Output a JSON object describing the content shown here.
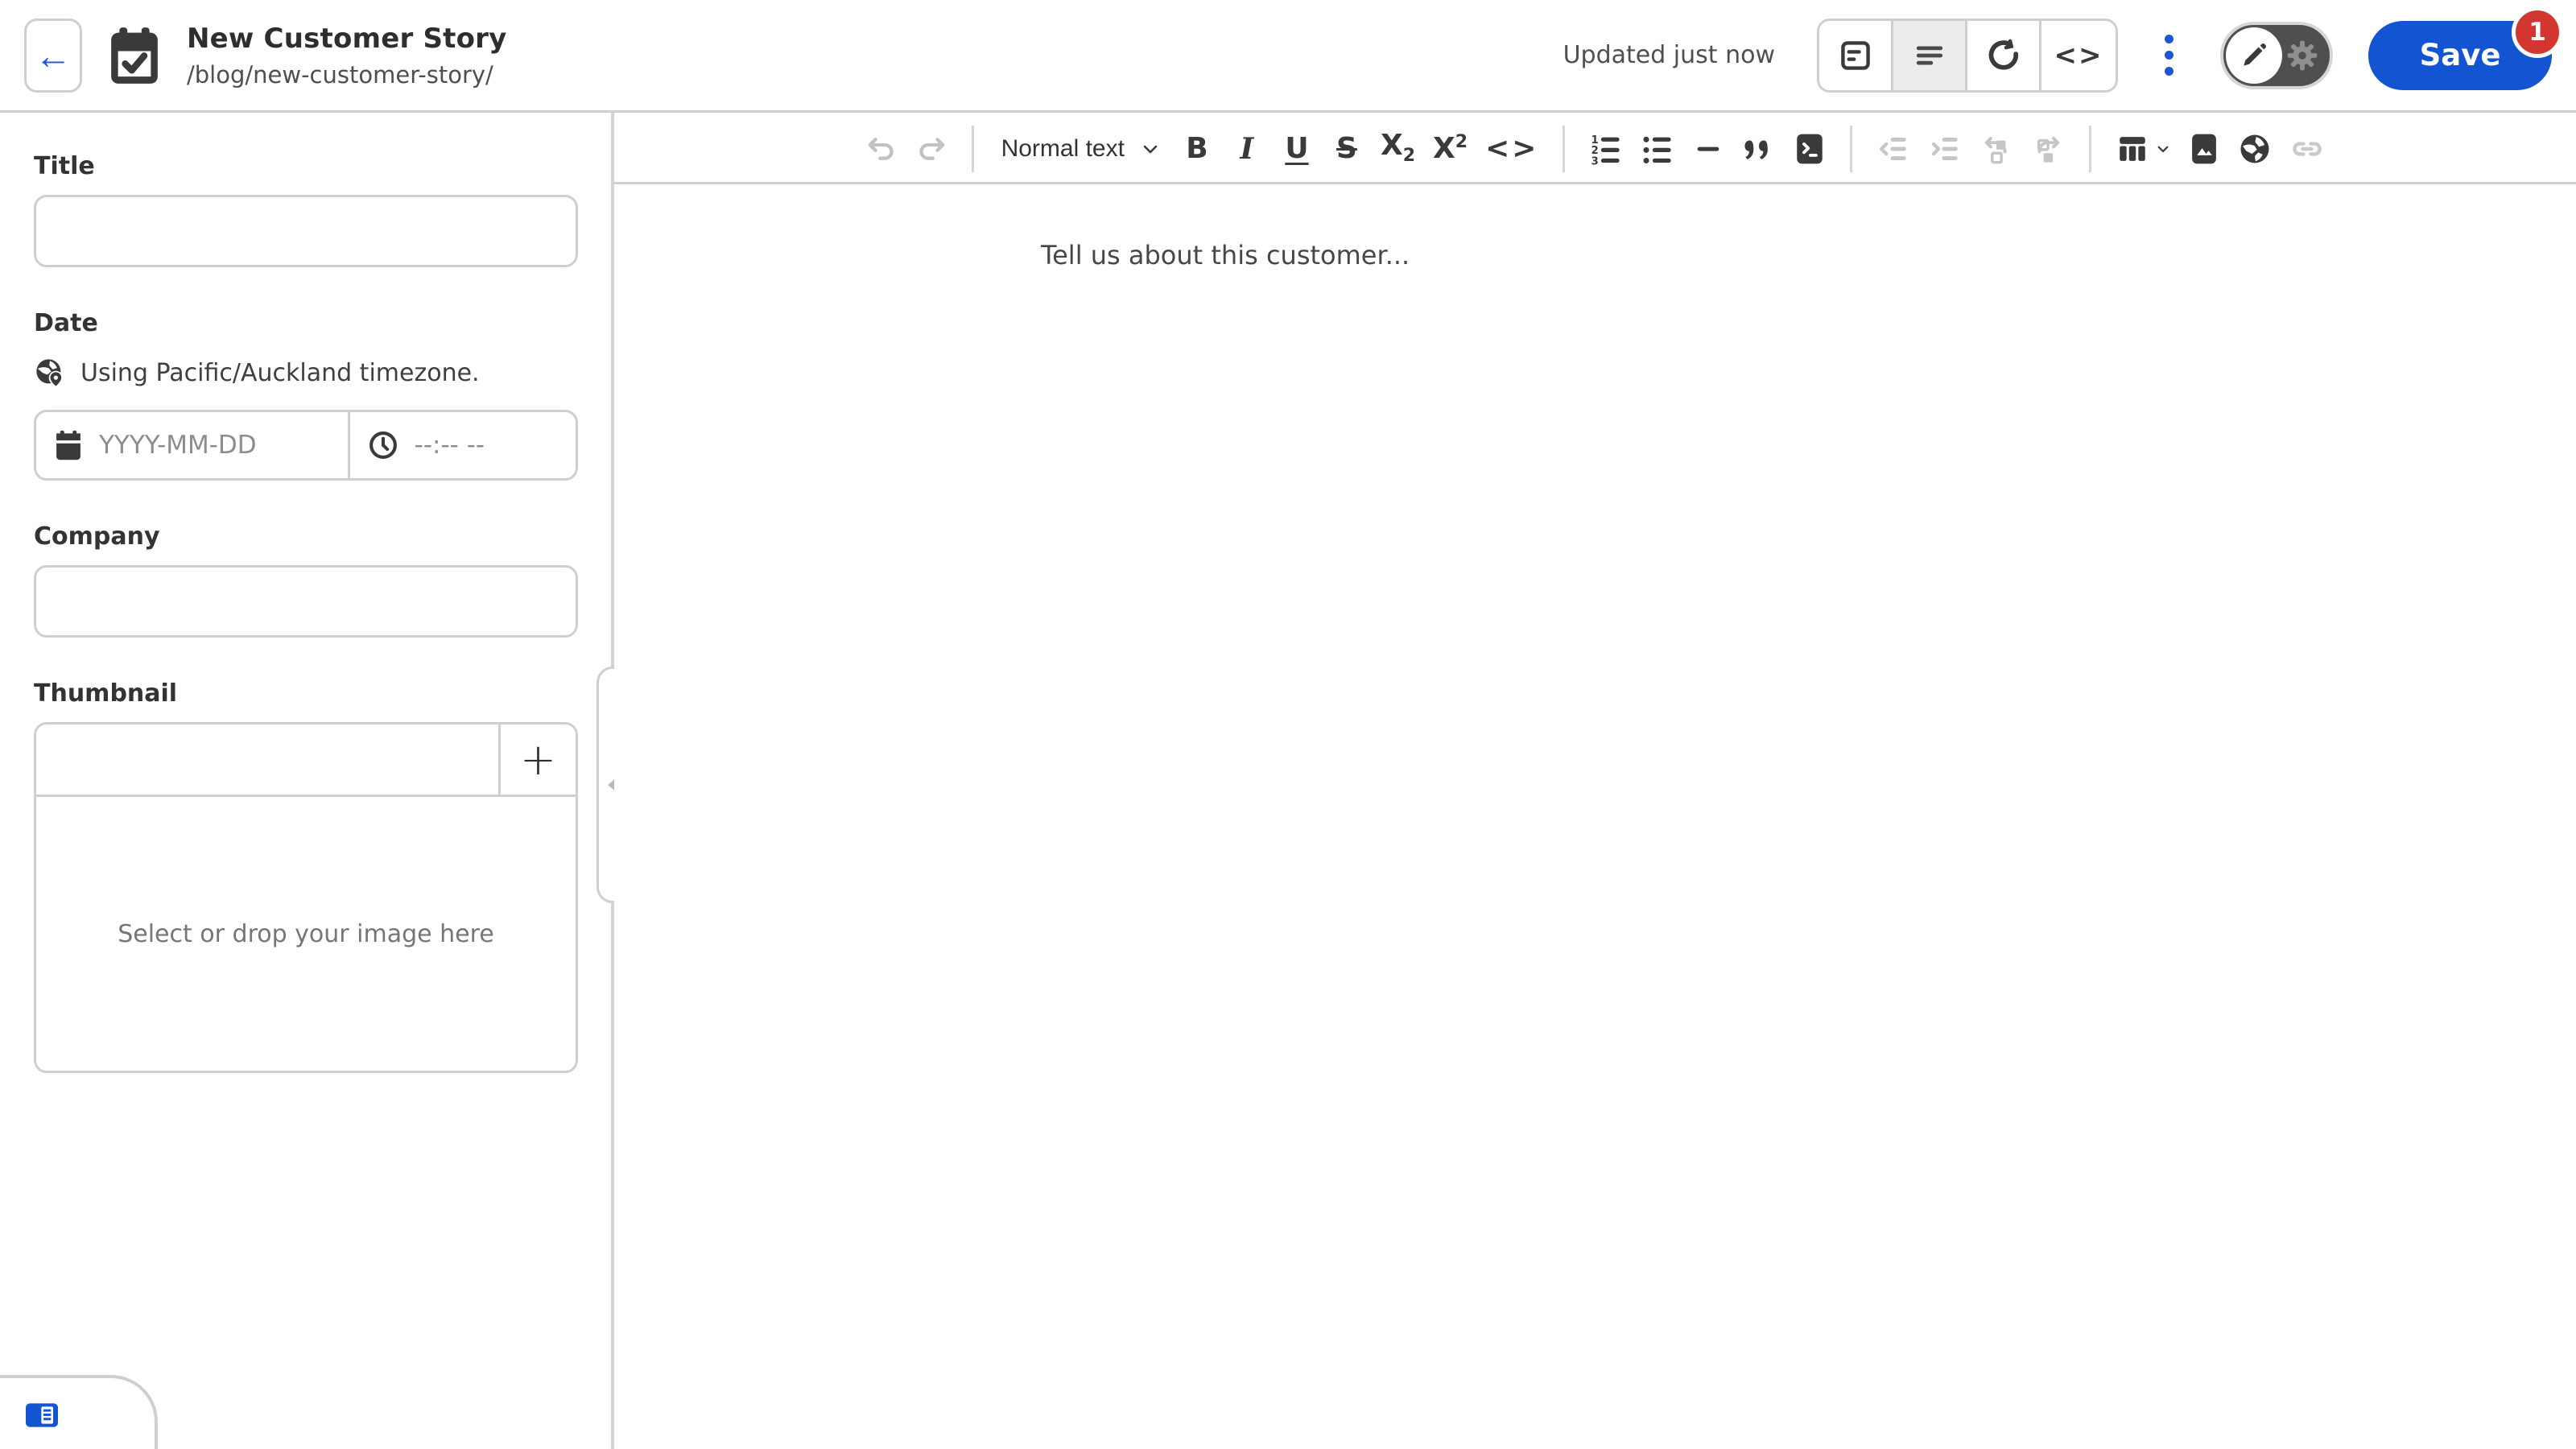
{
  "header": {
    "title": "New Customer Story",
    "path": "/blog/new-customer-story/",
    "status_text": "Updated just now",
    "save": {
      "label": "Save",
      "badge": "1"
    },
    "view_switcher": {
      "modes": [
        {
          "name": "visual-editor",
          "selected": false
        },
        {
          "name": "content-editor",
          "selected": true
        },
        {
          "name": "preview",
          "selected": false
        },
        {
          "name": "source-editor",
          "selected": false
        }
      ]
    },
    "mode_toggle": {
      "options": [
        "edit",
        "settings"
      ],
      "selected": "edit"
    }
  },
  "sidebar": {
    "title_field": {
      "label": "Title",
      "value": "",
      "placeholder": ""
    },
    "date_field": {
      "label": "Date",
      "timezone_note": "Using Pacific/Auckland timezone.",
      "date_value": "",
      "date_placeholder": "YYYY-MM-DD",
      "time_value": "",
      "time_placeholder": "--:-- --"
    },
    "company_field": {
      "label": "Company",
      "value": "",
      "placeholder": ""
    },
    "thumbnail_field": {
      "label": "Thumbnail",
      "value": "",
      "add_label": "+",
      "dropzone_text": "Select or drop your image here"
    }
  },
  "editor": {
    "placeholder": "Tell us about this customer...",
    "toolbar": {
      "format_select": "Normal text",
      "buttons": [
        {
          "name": "undo",
          "enabled": false
        },
        {
          "name": "redo",
          "enabled": false
        },
        {
          "name": "format-dropdown",
          "enabled": true
        },
        {
          "name": "bold",
          "enabled": true
        },
        {
          "name": "italic",
          "enabled": true
        },
        {
          "name": "underline",
          "enabled": true
        },
        {
          "name": "strikethrough",
          "enabled": true
        },
        {
          "name": "subscript",
          "enabled": true
        },
        {
          "name": "superscript",
          "enabled": true
        },
        {
          "name": "inline-code",
          "enabled": true
        },
        {
          "name": "ordered-list",
          "enabled": true
        },
        {
          "name": "bullet-list",
          "enabled": true
        },
        {
          "name": "horizontal-rule",
          "enabled": true
        },
        {
          "name": "blockquote",
          "enabled": true
        },
        {
          "name": "code-block",
          "enabled": true
        },
        {
          "name": "outdent",
          "enabled": false
        },
        {
          "name": "indent",
          "enabled": false
        },
        {
          "name": "rotate-left",
          "enabled": false
        },
        {
          "name": "rotate-right",
          "enabled": false
        },
        {
          "name": "table",
          "enabled": true
        },
        {
          "name": "image",
          "enabled": true
        },
        {
          "name": "globe",
          "enabled": true
        },
        {
          "name": "link",
          "enabled": false
        }
      ]
    }
  },
  "glyphs": {
    "back_arrow": "←",
    "bold": "B",
    "italic": "I",
    "underline": "U",
    "strikethrough": "S",
    "inline_code": "<>",
    "seg_code": "<>"
  },
  "colors": {
    "accent_blue": "#1254d1",
    "badge_red": "#d2362f",
    "border_gray": "#cfcfcf",
    "icon_dark": "#3a3a3a",
    "icon_disabled": "#c2c2c2",
    "selected_segment_bg": "#ececec",
    "toggle_track": "#4f4f4f"
  }
}
